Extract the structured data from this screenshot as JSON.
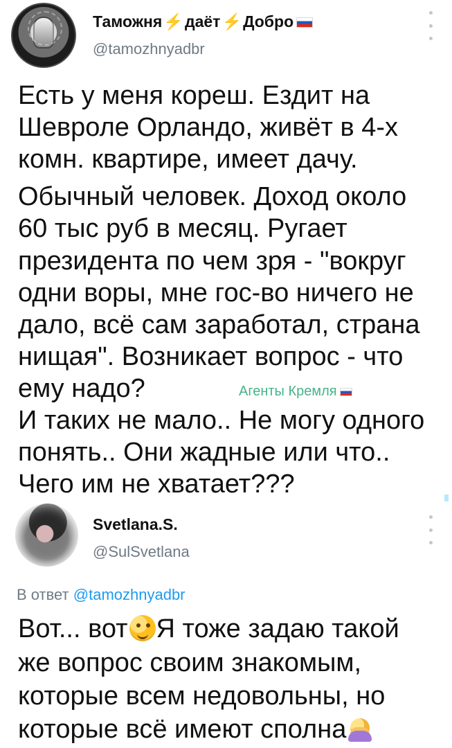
{
  "post": {
    "display_name_part_1": "Таможня",
    "display_name_part_2": "даёт",
    "display_name_part_3": "Добро",
    "handle": "@tamozhnyadbr",
    "text_lines": [
      "Есть у меня кореш. Ездит на",
      "Шевроле Орландо, живёт в 4-х",
      "комн. квартире, имеет дачу.",
      "Обычный человек. Доход около",
      "60 тыс руб в месяц. Ругает",
      "президента по чем зря - \"вокруг",
      "одни воры, мне гос-во ничего не",
      "дало, всё сам заработал, страна",
      "нищая\". Возникает вопрос - что",
      "ему надо?",
      "И таких не мало.. Не могу одного",
      "понять.. Они жадные или что..",
      "Чего им не хватает???"
    ],
    "watermark": "Агенты Кремля"
  },
  "reply": {
    "display_name": "Svetlana.S.",
    "handle": "@SulSvetlana",
    "reply_prefix": "В ответ",
    "reply_handle": "@tamozhnyadbr",
    "text_lines": [
      "Вот... вот",
      "Я тоже задаю такой",
      "же вопрос своим знакомым,",
      "которые всем недовольны, но",
      "которые всё имеют сполна"
    ]
  },
  "icons": {
    "lightning": "⚡",
    "flag": "russian-flag-icon",
    "menu": "vertical-more-icon",
    "thinking": "thinking-face-icon",
    "facepalm": "facepalm-icon"
  },
  "colors": {
    "text": "#111111",
    "muted": "#6f7a85",
    "link": "#1d9bf0",
    "watermark": "#45b38a",
    "bolt": "#f5b400"
  }
}
